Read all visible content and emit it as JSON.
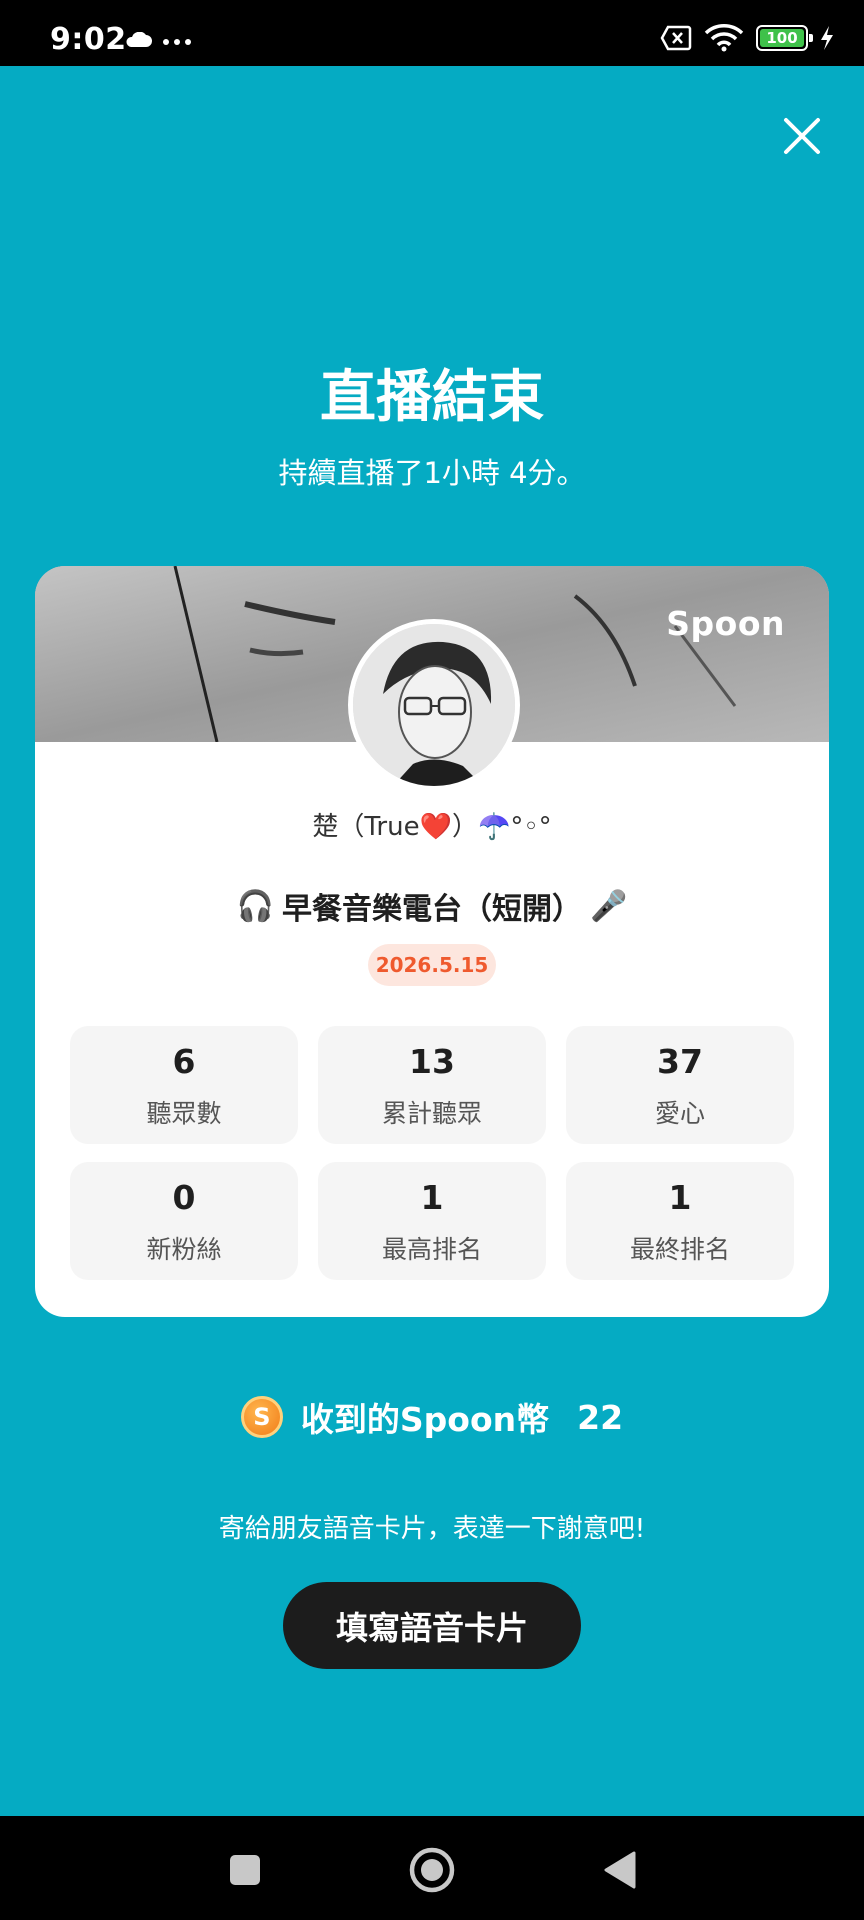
{
  "status_bar": {
    "time": "9:02",
    "battery": "100",
    "icons": [
      "cloud-icon",
      "more-dots-icon",
      "no-sim-icon",
      "wifi-icon",
      "battery-icon",
      "charging-icon"
    ]
  },
  "header": {
    "title": "直播結束",
    "subtitle": "持續直播了1小時 4分。"
  },
  "card": {
    "brand": "Spoon",
    "host_name": "楚（True❤️）☂️°◦°",
    "title_prefix_icon": "🎧",
    "stream_title": "早餐音樂電台（短開）",
    "title_suffix_icon": "🎤",
    "date": "2026.5.15",
    "stats": [
      {
        "value": "6",
        "label": "聽眾數"
      },
      {
        "value": "13",
        "label": "累計聽眾"
      },
      {
        "value": "37",
        "label": "愛心"
      },
      {
        "value": "0",
        "label": "新粉絲"
      },
      {
        "value": "1",
        "label": "最高排名"
      },
      {
        "value": "1",
        "label": "最終排名"
      }
    ]
  },
  "coins": {
    "icon_letter": "S",
    "label": "收到的Spoon幣",
    "value": "22"
  },
  "prompt": "寄給朋友語音卡片，表達一下謝意吧!",
  "voice_card_button": "填寫語音卡片",
  "colors": {
    "background": "#05abc3",
    "card": "#ffffff",
    "accent_orange": "#ef5a2e",
    "button_dark": "#1c1c1c"
  }
}
